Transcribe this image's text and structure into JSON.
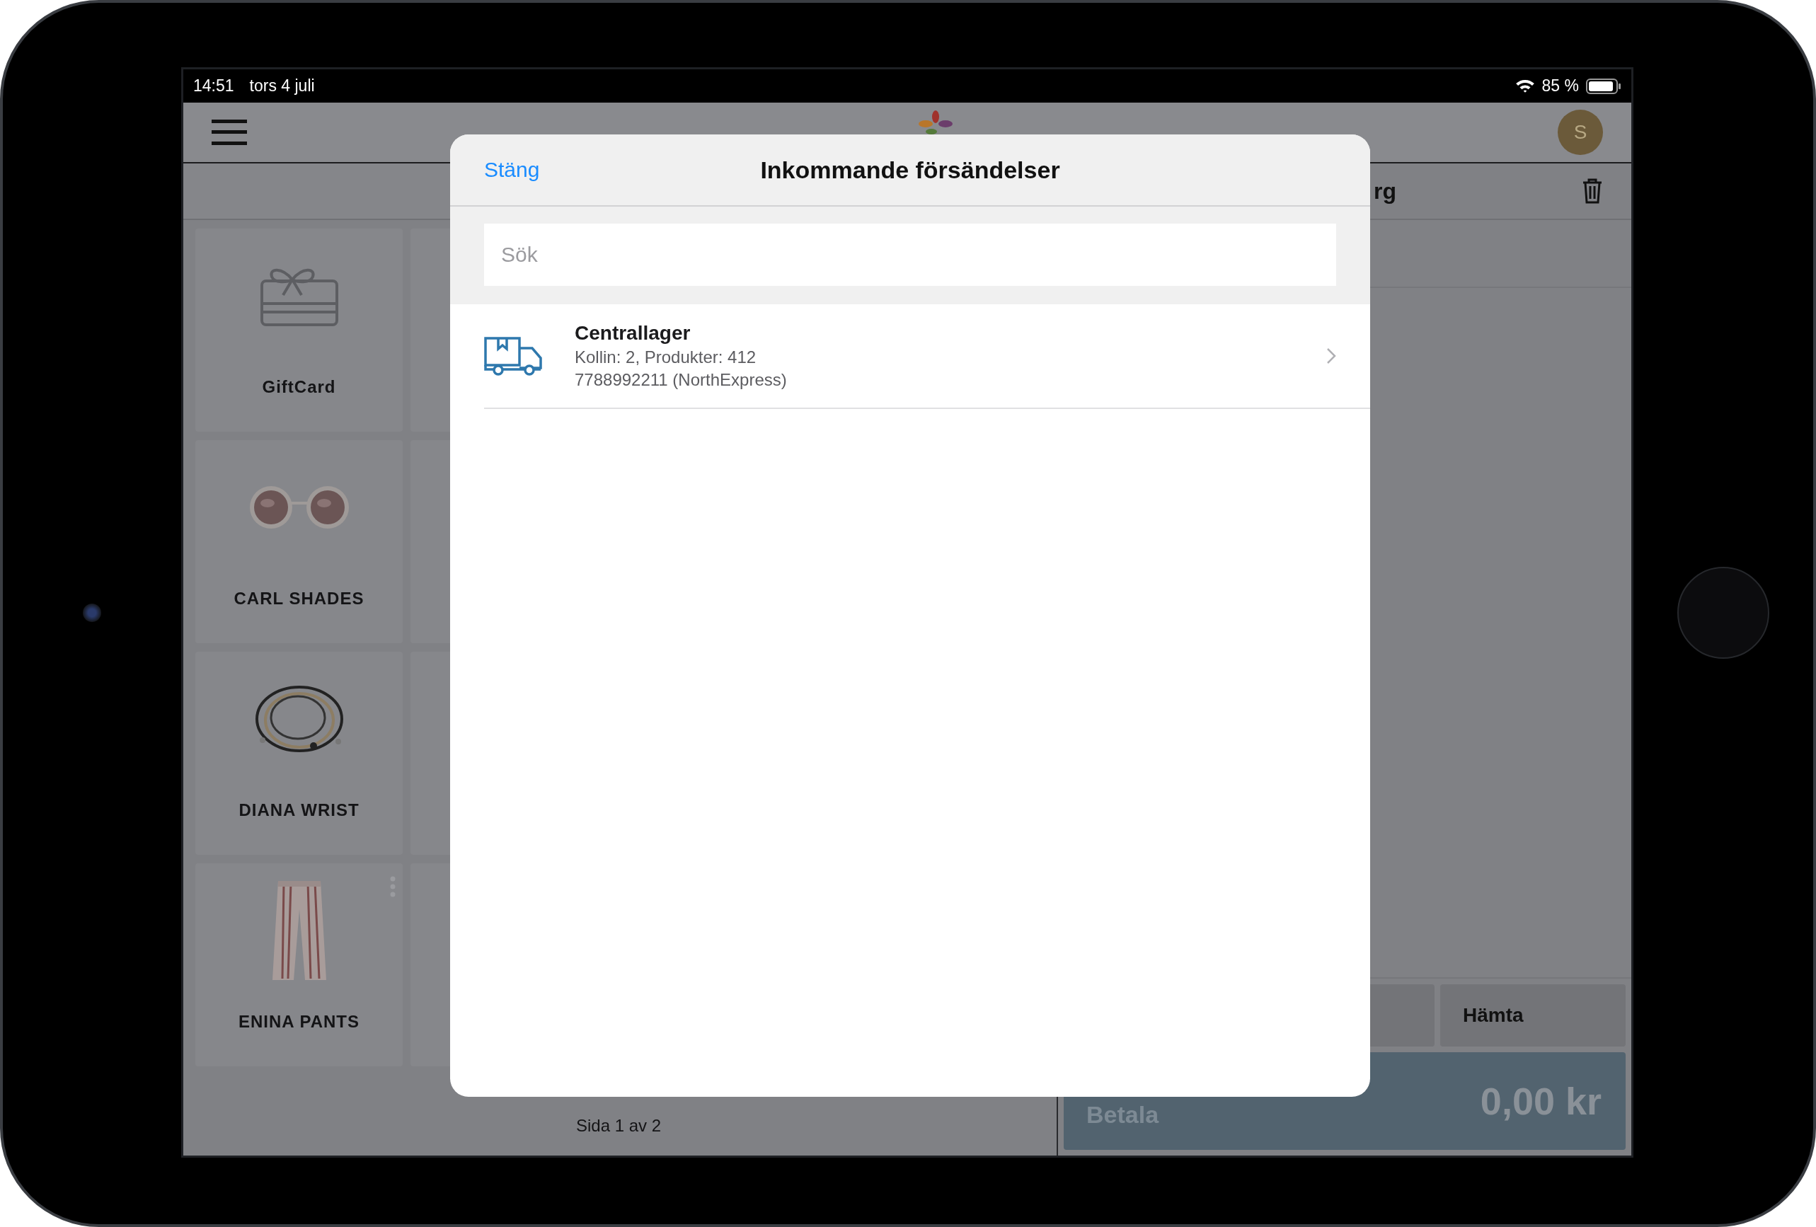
{
  "status_bar": {
    "time": "14:51",
    "date": "tors 4 juli",
    "battery": "85 %"
  },
  "header": {
    "avatar": "S"
  },
  "products": [
    {
      "name": "GiftCard",
      "kind": "giftcard",
      "menu": false
    },
    {
      "name": "CARL SHADES",
      "kind": "picture",
      "menu": false
    },
    {
      "name": "DIANA WRIST",
      "kind": "picture",
      "menu": false
    },
    {
      "name": "ENINA PANTS",
      "kind": "picture",
      "menu": true
    }
  ],
  "pagination": "Sida 1 av 2",
  "cart": {
    "title": "rg",
    "buttons": [
      "Hämta"
    ],
    "pay_label": "Betala",
    "total": "0,00 kr"
  },
  "modal": {
    "close": "Stäng",
    "title": "Inkommande försändelser",
    "search": {
      "placeholder": "Sök"
    },
    "rows": [
      {
        "title": "Centrallager",
        "line_1": "Kollin: 2, Produkter: 412",
        "line_2": "7788992211 (NorthExpress)"
      }
    ]
  }
}
